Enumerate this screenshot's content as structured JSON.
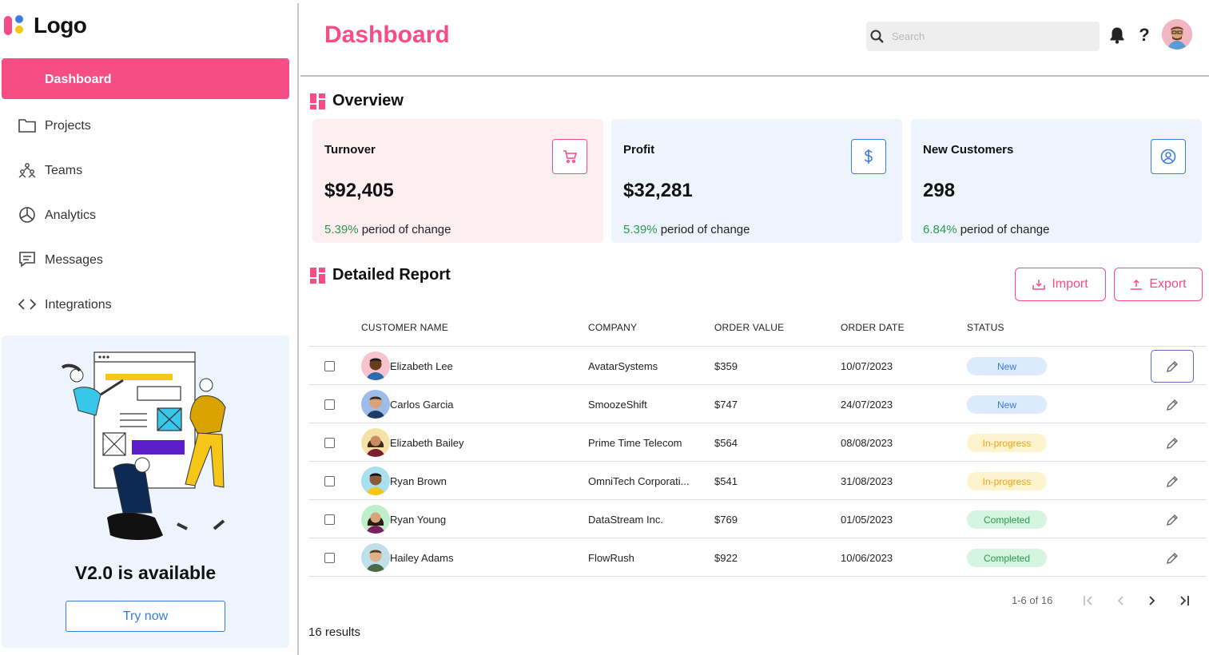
{
  "app": {
    "logo_text": "Logo",
    "accent": "#f54d84"
  },
  "sidebar": {
    "items": [
      {
        "label": "Dashboard",
        "icon": "none",
        "active": true
      },
      {
        "label": "Projects",
        "icon": "folder-icon"
      },
      {
        "label": "Teams",
        "icon": "teams-icon"
      },
      {
        "label": "Analytics",
        "icon": "pie-chart-icon"
      },
      {
        "label": "Messages",
        "icon": "message-icon"
      },
      {
        "label": "Integrations",
        "icon": "code-icon"
      }
    ],
    "promo": {
      "title": "V2.0 is available",
      "button": "Try now"
    }
  },
  "header": {
    "title": "Dashboard",
    "search_placeholder": "Search",
    "help_glyph": "?"
  },
  "overview": {
    "title": "Overview",
    "cards": [
      {
        "title": "Turnover",
        "value": "$92,405",
        "pct": "5.39%",
        "change_text": " period of change",
        "icon": "cart-icon",
        "bg": "#fdeef2",
        "icon_color": "#f54d84"
      },
      {
        "title": "Profit",
        "value": "$32,281",
        "pct": "5.39%",
        "change_text": " period of change",
        "icon": "dollar-icon",
        "bg": "#eef4fd",
        "icon_color": "#3b7ddd"
      },
      {
        "title": "New Customers",
        "value": "298",
        "pct": "6.84%",
        "change_text": " period of change",
        "icon": "user-circle-icon",
        "bg": "#eef4fd",
        "icon_color": "#3b7ddd"
      }
    ]
  },
  "report": {
    "title": "Detailed Report",
    "import_label": "Import",
    "export_label": "Export",
    "columns": [
      "CUSTOMER NAME",
      "COMPANY",
      "ORDER VALUE",
      "ORDER DATE",
      "STATUS"
    ],
    "rows": [
      {
        "name": "Elizabeth Lee",
        "company": "AvatarSystems",
        "value": "$359",
        "date": "10/07/2023",
        "status": "New"
      },
      {
        "name": "Carlos Garcia",
        "company": "SmoozeShift",
        "value": "$747",
        "date": "24/07/2023",
        "status": "New"
      },
      {
        "name": "Elizabeth Bailey",
        "company": "Prime Time Telecom",
        "value": "$564",
        "date": "08/08/2023",
        "status": "In-progress"
      },
      {
        "name": "Ryan Brown",
        "company": "OmniTech Corporati...",
        "value": "$541",
        "date": "31/08/2023",
        "status": "In-progress"
      },
      {
        "name": "Ryan Young",
        "company": "DataStream Inc.",
        "value": "$769",
        "date": "01/05/2023",
        "status": "Completed"
      },
      {
        "name": "Hailey Adams",
        "company": "FlowRush",
        "value": "$922",
        "date": "10/06/2023",
        "status": "Completed"
      }
    ],
    "pagination": "1-6 of 16",
    "results": "16 results"
  }
}
